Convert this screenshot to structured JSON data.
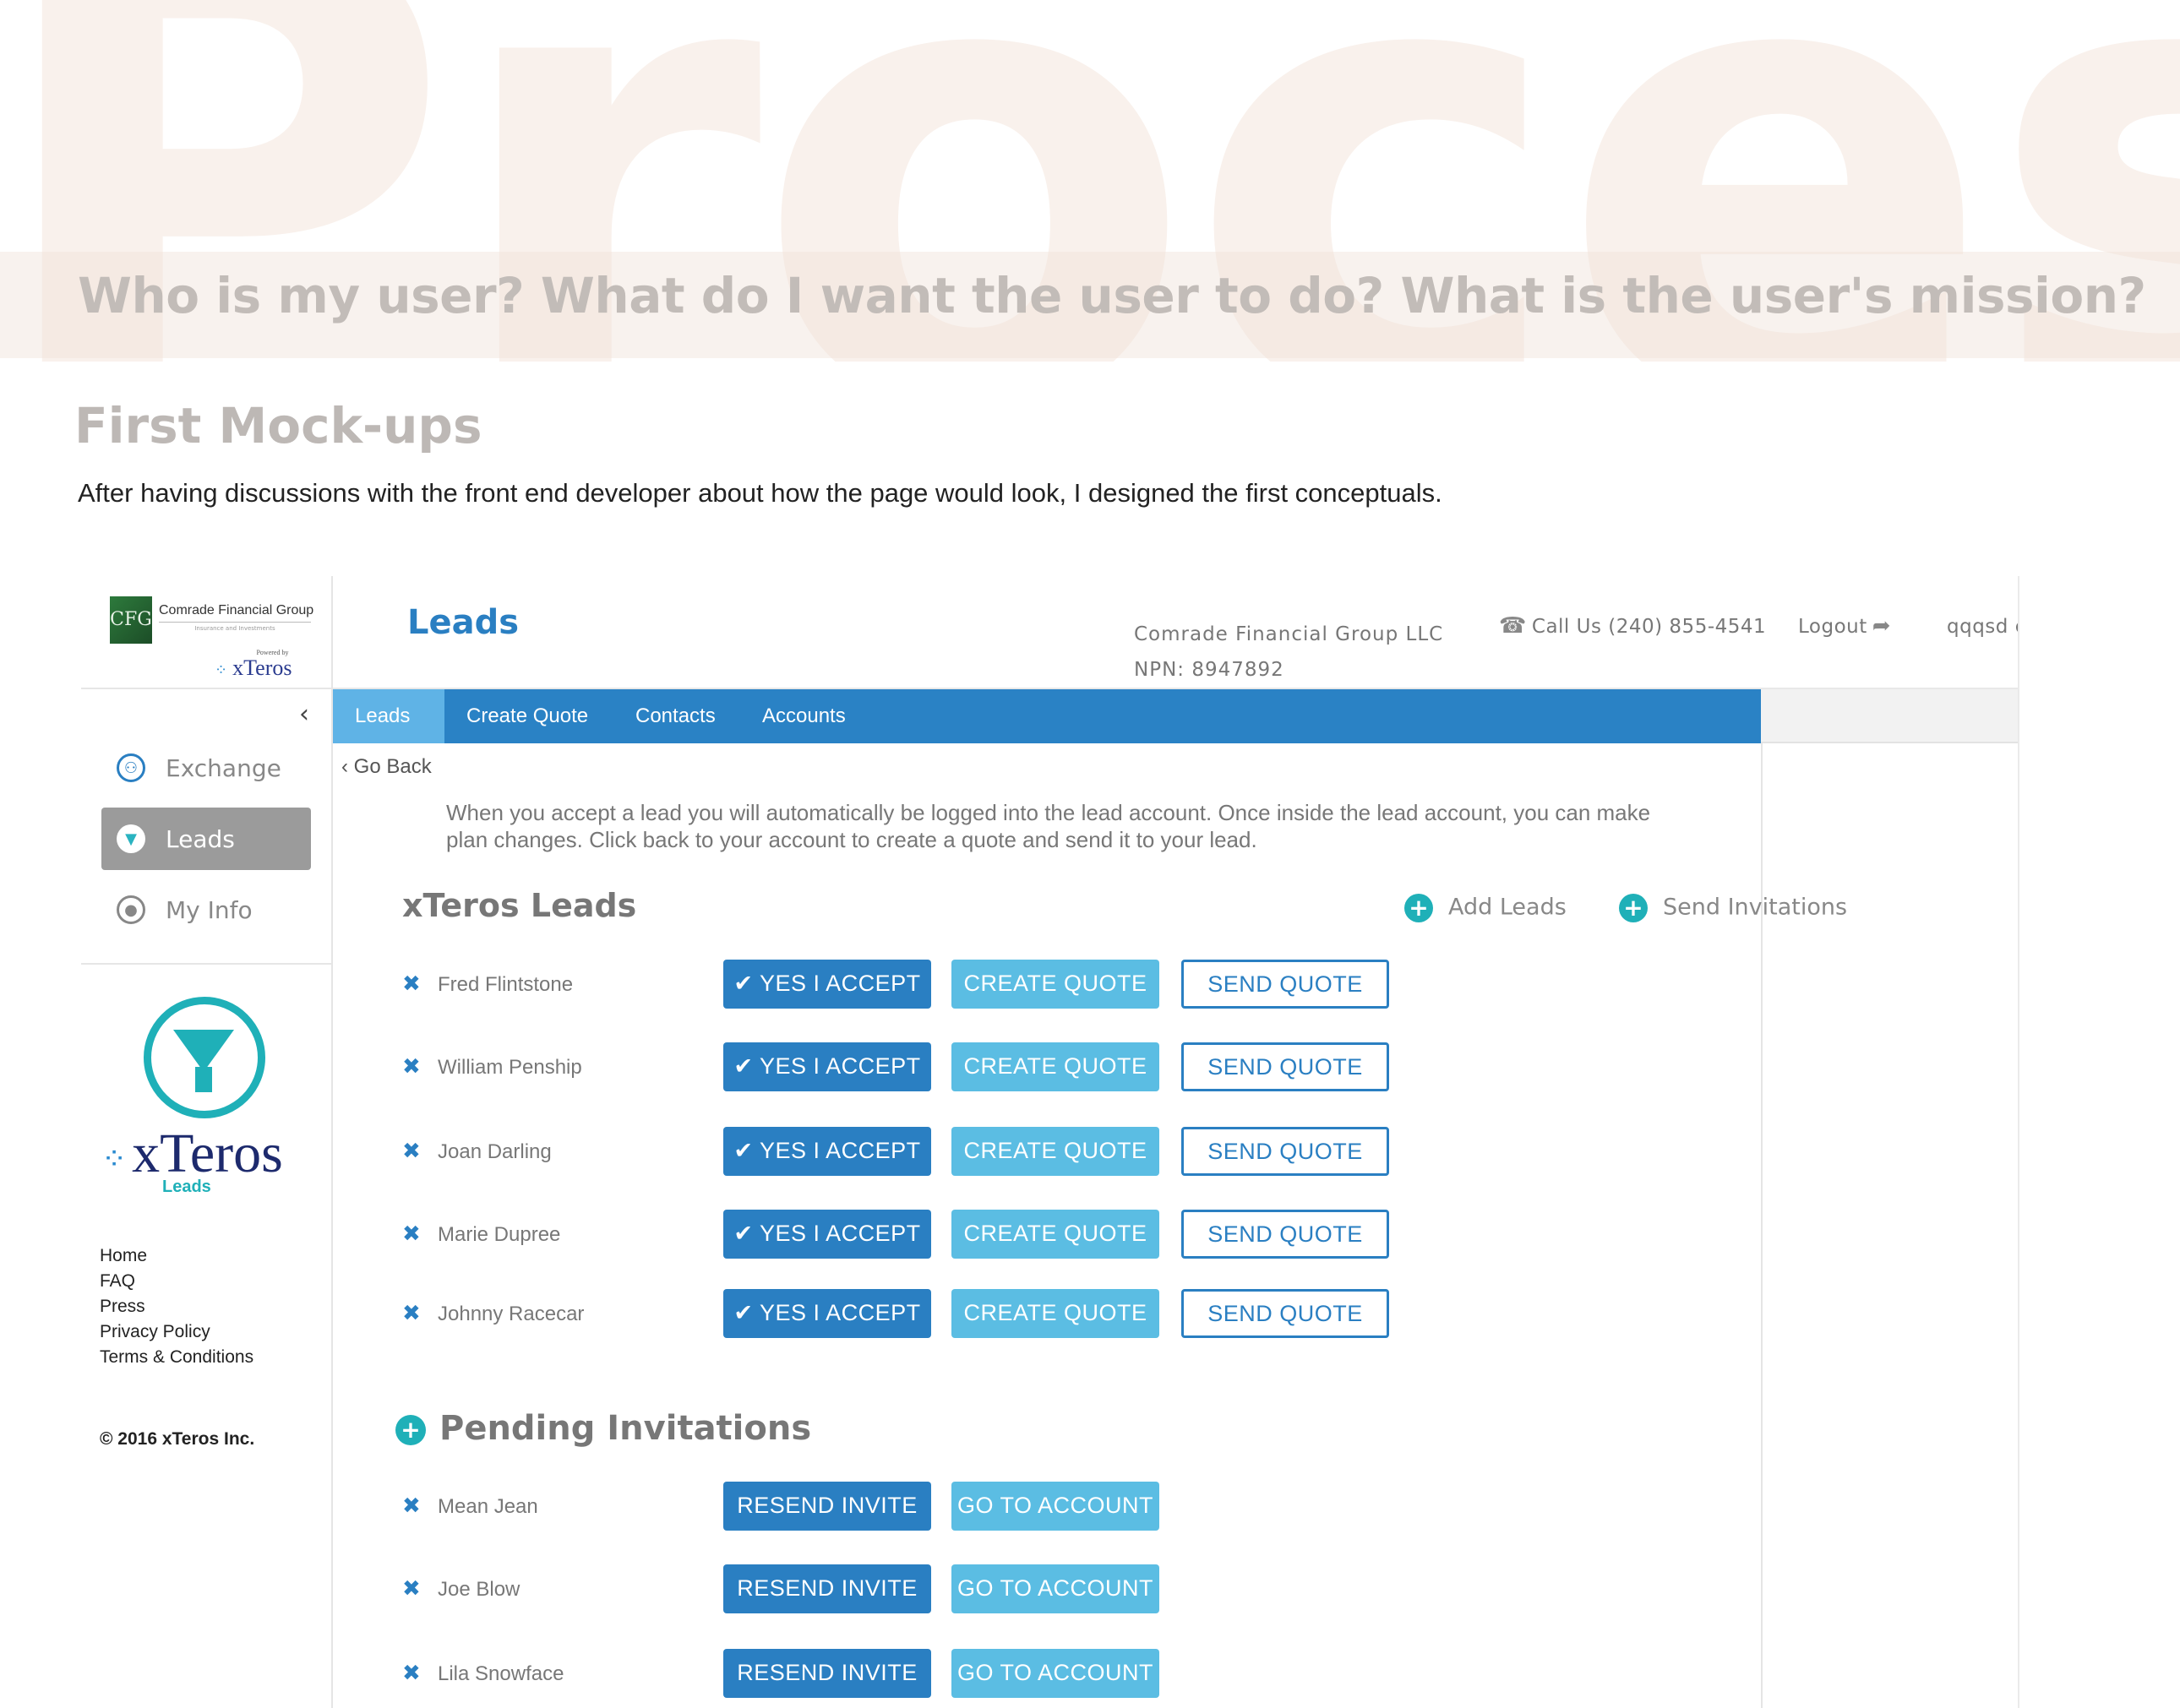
{
  "hero": {
    "watermark": "Process",
    "question": "Who is my user?  What do I want the user to do?  What is the user's mission?"
  },
  "section": {
    "title": "First Mock-ups",
    "description": "After having discussions with the front end developer about how the page would look, I designed the first conceptuals."
  },
  "mockup": {
    "sidebar": {
      "company_logo": {
        "mark": "CFG",
        "name": "Comrade Financial Group",
        "tagline": "Insurance and Investments"
      },
      "powered_by": {
        "label": "Powered by",
        "brand": "xTeros"
      },
      "collapse_glyph": "‹",
      "items": [
        {
          "label": "Exchange",
          "icon": "exchange-icon",
          "active": false
        },
        {
          "label": "Leads",
          "icon": "funnel-icon",
          "active": true
        },
        {
          "label": "My Info",
          "icon": "user-icon",
          "active": false
        }
      ],
      "product_logo": {
        "brand": "xTeros",
        "sub": "Leads"
      },
      "footer_links": [
        "Home",
        "FAQ",
        "Press",
        "Privacy Policy",
        "Terms & Conditions"
      ],
      "copyright": "© 2016 xTeros Inc."
    },
    "header": {
      "page_title": "Leads",
      "company_name": "Comrade Financial Group LLC",
      "npn": "NPN: 8947892",
      "call_us": "Call Us (240) 855-4541",
      "logout": "Logout",
      "user_name": "qqqsd ccc"
    },
    "nav_tabs": [
      {
        "label": "Leads",
        "active": true
      },
      {
        "label": "Create Quote",
        "active": false
      },
      {
        "label": "Contacts",
        "active": false
      },
      {
        "label": "Accounts",
        "active": false
      }
    ],
    "go_back": "Go Back",
    "notice": "When you accept a lead you will automatically be logged into the lead account.  Once inside the lead account, you can make plan changes.  Click back to your account to create a quote and send it to your lead.",
    "leads_section": {
      "title": "xTeros Leads",
      "add_leads": "Add Leads",
      "send_invitations": "Send Invitations",
      "accept_label": "YES I ACCEPT",
      "create_quote_label": "CREATE QUOTE",
      "send_quote_label": "SEND QUOTE",
      "leads": [
        "Fred Flintstone",
        "William Penship",
        "Joan Darling",
        "Marie Dupree",
        "Johnny Racecar"
      ]
    },
    "pending_section": {
      "title": "Pending Invitations",
      "resend_label": "RESEND INVITE",
      "goto_label": "GO TO ACCOUNT",
      "invites": [
        "Mean Jean",
        "Joe Blow",
        "Lila Snowface"
      ]
    },
    "colors": {
      "primary_blue": "#2a7fc2",
      "nav_blue": "#2a82c5",
      "light_blue": "#5bbde3",
      "teal": "#1fb0b8"
    }
  }
}
